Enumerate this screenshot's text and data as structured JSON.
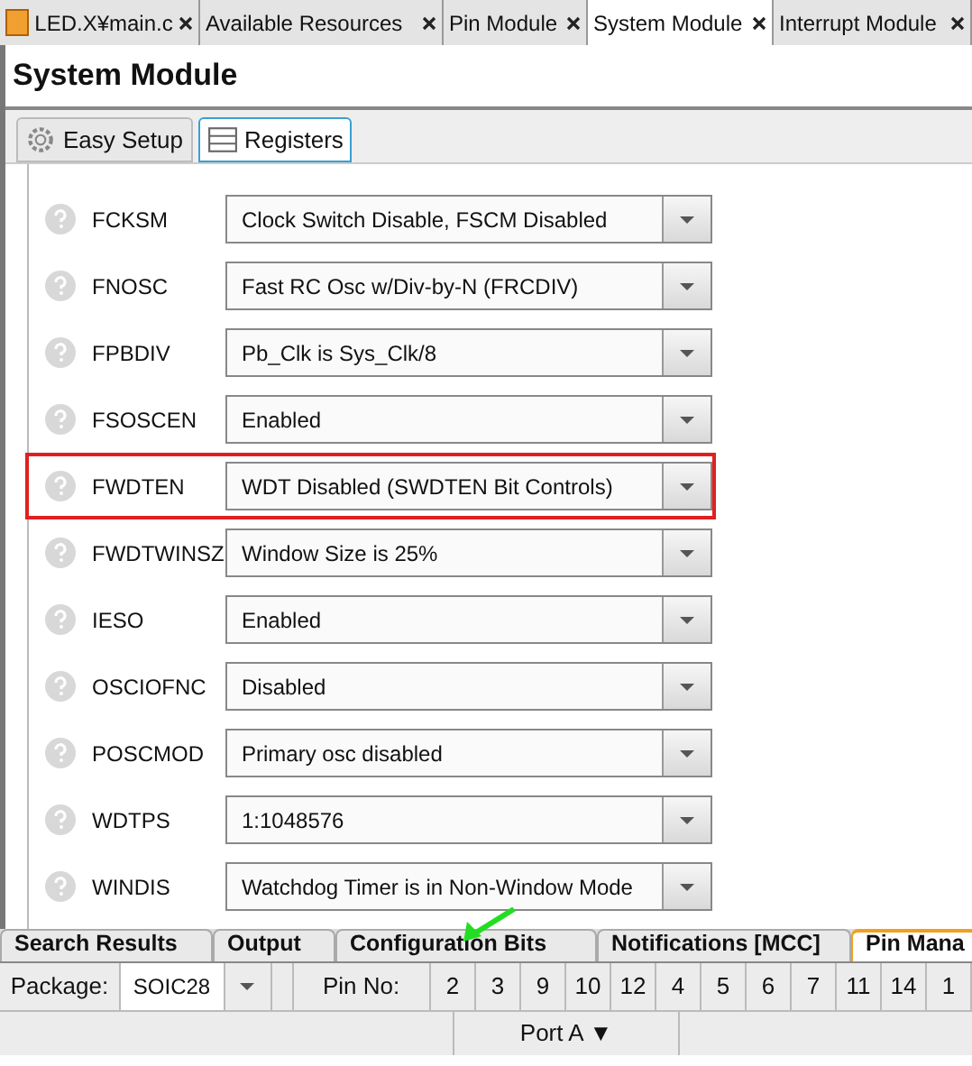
{
  "editor_tabs": [
    {
      "label": "LED.X¥main.c",
      "kind": "file",
      "selected": false
    },
    {
      "label": "Available Resources",
      "kind": "view",
      "selected": false
    },
    {
      "label": "Pin Module",
      "kind": "view",
      "selected": false
    },
    {
      "label": "System Module",
      "kind": "view",
      "selected": true
    },
    {
      "label": "Interrupt Module",
      "kind": "view",
      "selected": false
    }
  ],
  "title": "System Module",
  "sub_tabs": [
    {
      "label": "Easy Setup",
      "kind": "gear",
      "selected": false
    },
    {
      "label": "Registers",
      "kind": "table",
      "selected": true
    }
  ],
  "settings": [
    {
      "name": "FCKSM",
      "value": "Clock Switch Disable, FSCM Disabled",
      "highlighted": false
    },
    {
      "name": "FNOSC",
      "value": "Fast RC Osc w/Div-by-N (FRCDIV)",
      "highlighted": false
    },
    {
      "name": "FPBDIV",
      "value": "Pb_Clk is Sys_Clk/8",
      "highlighted": false
    },
    {
      "name": "FSOSCEN",
      "value": "Enabled",
      "highlighted": false
    },
    {
      "name": "FWDTEN",
      "value": "WDT Disabled (SWDTEN Bit Controls)",
      "highlighted": true
    },
    {
      "name": "FWDTWINSZ",
      "value": "Window Size is 25%",
      "highlighted": false
    },
    {
      "name": "IESO",
      "value": "Enabled",
      "highlighted": false
    },
    {
      "name": "OSCIOFNC",
      "value": "Disabled",
      "highlighted": false
    },
    {
      "name": "POSCMOD",
      "value": "Primary osc disabled",
      "highlighted": false
    },
    {
      "name": "WDTPS",
      "value": "1:1048576",
      "highlighted": false
    },
    {
      "name": "WINDIS",
      "value": "Watchdog Timer is in Non-Window Mode",
      "highlighted": false
    }
  ],
  "bottom_tabs": [
    {
      "label": "Search Results",
      "selected": false
    },
    {
      "label": "Output",
      "selected": false
    },
    {
      "label": "Configuration Bits",
      "selected": false
    },
    {
      "label": "Notifications [MCC]",
      "selected": false
    },
    {
      "label": "Pin Mana",
      "selected": true
    }
  ],
  "pin_table": {
    "package_label": "Package:",
    "package_value": "SOIC28",
    "pin_no_label": "Pin No:",
    "pins": [
      "2",
      "3",
      "9",
      "10",
      "12",
      "4",
      "5",
      "6",
      "7",
      "11",
      "14",
      "1"
    ],
    "port_label": "Port A ▼"
  }
}
